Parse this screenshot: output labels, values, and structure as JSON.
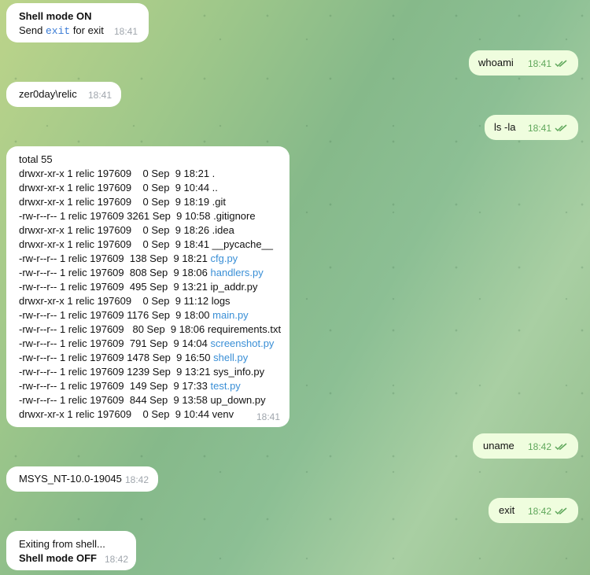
{
  "messages": {
    "shell_on": {
      "title": "Shell mode ON",
      "send_prefix": "Send ",
      "code": "exit",
      "send_suffix": " for exit",
      "time": "18:41"
    },
    "whoami": {
      "text": "whoami",
      "time": "18:41"
    },
    "whoami_reply": {
      "text": "zer0day\\relic",
      "time": "18:41"
    },
    "ls": {
      "text": "ls -la",
      "time": "18:41"
    },
    "ls_reply": {
      "time": "18:41",
      "lines": [
        {
          "prefix": "total 55",
          "link": ""
        },
        {
          "prefix": "drwxr-xr-x 1 relic 197609    0 Sep  9 18:21 .",
          "link": ""
        },
        {
          "prefix": "drwxr-xr-x 1 relic 197609    0 Sep  9 10:44 ..",
          "link": ""
        },
        {
          "prefix": "drwxr-xr-x 1 relic 197609    0 Sep  9 18:19 .git",
          "link": ""
        },
        {
          "prefix": "-rw-r--r-- 1 relic 197609 3261 Sep  9 10:58 .gitignore",
          "link": ""
        },
        {
          "prefix": "drwxr-xr-x 1 relic 197609    0 Sep  9 18:26 .idea",
          "link": ""
        },
        {
          "prefix": "drwxr-xr-x 1 relic 197609    0 Sep  9 18:41 __pycache__",
          "link": ""
        },
        {
          "prefix": "-rw-r--r-- 1 relic 197609  138 Sep  9 18:21 ",
          "link": "cfg.py"
        },
        {
          "prefix": "-rw-r--r-- 1 relic 197609  808 Sep  9 18:06 ",
          "link": "handlers.py"
        },
        {
          "prefix": "-rw-r--r-- 1 relic 197609  495 Sep  9 13:21 ip_addr.py",
          "link": ""
        },
        {
          "prefix": "drwxr-xr-x 1 relic 197609    0 Sep  9 11:12 logs",
          "link": ""
        },
        {
          "prefix": "-rw-r--r-- 1 relic 197609 1176 Sep  9 18:00 ",
          "link": "main.py"
        },
        {
          "prefix": "-rw-r--r-- 1 relic 197609   80 Sep  9 18:06 requirements.txt",
          "link": ""
        },
        {
          "prefix": "-rw-r--r-- 1 relic 197609  791 Sep  9 14:04 ",
          "link": "screenshot.py"
        },
        {
          "prefix": "-rw-r--r-- 1 relic 197609 1478 Sep  9 16:50 ",
          "link": "shell.py"
        },
        {
          "prefix": "-rw-r--r-- 1 relic 197609 1239 Sep  9 13:21 sys_info.py",
          "link": ""
        },
        {
          "prefix": "-rw-r--r-- 1 relic 197609  149 Sep  9 17:33 ",
          "link": "test.py"
        },
        {
          "prefix": "-rw-r--r-- 1 relic 197609  844 Sep  9 13:58 up_down.py",
          "link": ""
        },
        {
          "prefix": "drwxr-xr-x 1 relic 197609    0 Sep  9 10:44 venv",
          "link": ""
        }
      ]
    },
    "uname": {
      "text": "uname",
      "time": "18:42"
    },
    "uname_reply": {
      "text": "MSYS_NT-10.0-19045",
      "time": "18:42"
    },
    "exit": {
      "text": "exit",
      "time": "18:42"
    },
    "shell_off": {
      "line1": "Exiting from shell...",
      "line2": "Shell mode OFF",
      "time": "18:42"
    }
  },
  "colors": {
    "incoming": "#ffffff",
    "outgoing": "#effdde",
    "link": "#3a8fd6",
    "read_check": "#5fa75b"
  },
  "icons": {
    "read_receipt": "double-check-icon"
  }
}
